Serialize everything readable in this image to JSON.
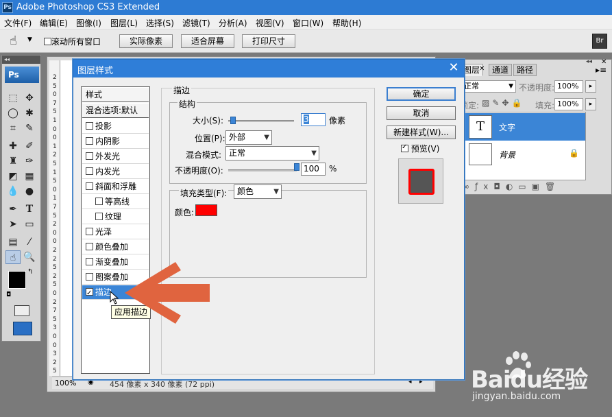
{
  "app": {
    "title": "Adobe Photoshop CS3 Extended",
    "icon": "Ps"
  },
  "menu": [
    "文件(F)",
    "编辑(E)",
    "图像(I)",
    "图层(L)",
    "选择(S)",
    "滤镜(T)",
    "分析(A)",
    "视图(V)",
    "窗口(W)",
    "帮助(H)"
  ],
  "options": {
    "scroll_all_label": "滚动所有窗口",
    "actual_pixels": "实际像素",
    "fit_screen": "适合屏幕",
    "print_size": "打印尺寸"
  },
  "toolbox": {
    "logo": "Ps"
  },
  "document": {
    "zoom": "100%",
    "status": "454 像素 x 340 像素 (72 ppi)",
    "ruler": [
      "2",
      "5",
      "0",
      "7",
      "5",
      "1",
      "0",
      "0",
      "1",
      "2",
      "5",
      "1",
      "5",
      "0",
      "1",
      "7",
      "5",
      "2",
      "0",
      "0",
      "2",
      "2",
      "5",
      "2",
      "5",
      "0",
      "2",
      "7",
      "5",
      "3",
      "0",
      "0",
      "3",
      "2",
      "5"
    ]
  },
  "layers_panel": {
    "tabs": [
      "图层",
      "通道",
      "路径"
    ],
    "blend_mode": "正常",
    "opacity_label": "不透明度:",
    "opacity": "100%",
    "lock_label": "锁定:",
    "fill_label": "填充:",
    "fill": "100%",
    "layers": [
      {
        "name": "文字",
        "thumb": "T",
        "selected": true
      },
      {
        "name": "背景",
        "thumb": "",
        "selected": false
      }
    ]
  },
  "dialog": {
    "title": "图层样式",
    "styles_header": "样式",
    "blend_options": "混合选项:默认",
    "styles": [
      {
        "label": "投影",
        "checked": false,
        "indent": false
      },
      {
        "label": "内阴影",
        "checked": false,
        "indent": false
      },
      {
        "label": "外发光",
        "checked": false,
        "indent": false
      },
      {
        "label": "内发光",
        "checked": false,
        "indent": false
      },
      {
        "label": "斜面和浮雕",
        "checked": false,
        "indent": false
      },
      {
        "label": "等高线",
        "checked": false,
        "indent": true
      },
      {
        "label": "纹理",
        "checked": false,
        "indent": true
      },
      {
        "label": "光泽",
        "checked": false,
        "indent": false
      },
      {
        "label": "颜色叠加",
        "checked": false,
        "indent": false
      },
      {
        "label": "渐变叠加",
        "checked": false,
        "indent": false
      },
      {
        "label": "图案叠加",
        "checked": false,
        "indent": false
      },
      {
        "label": "描边",
        "checked": true,
        "indent": false,
        "selected": true
      }
    ],
    "tooltip": "应用描边",
    "section_title": "描边",
    "structure_title": "结构",
    "size_label": "大小(S):",
    "size_value": "3",
    "size_unit": "像素",
    "position_label": "位置(P):",
    "position_value": "外部",
    "blend_label": "混合模式:",
    "blend_value": "正常",
    "opacity_label": "不透明度(O):",
    "opacity_value": "100",
    "opacity_unit": "%",
    "opacity_level_pct": 100,
    "size_level_pct": 3,
    "fill_type_label": "填充类型(F):",
    "fill_type_value": "颜色",
    "color_label": "颜色:",
    "stroke_color": "#ff0000",
    "buttons": {
      "ok": "确定",
      "cancel": "取消",
      "new_style": "新建样式(W)..."
    },
    "preview_label": "预览(V)",
    "preview_checked": true
  },
  "annotation": {
    "arrow_color": "#e0643f"
  },
  "watermark": {
    "text": "Baidu经验",
    "url": "jingyan.baidu.com"
  }
}
